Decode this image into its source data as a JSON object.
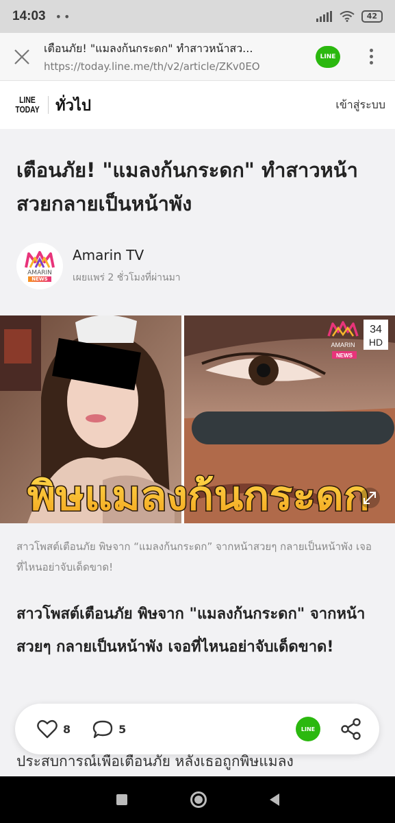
{
  "status_bar": {
    "time": "14:03",
    "dots": "••",
    "battery": "42"
  },
  "browser": {
    "page_title": "เตือนภัย! \"แมลงก้นกระดก\" ทำสาวหน้าสว...",
    "url": "https://today.line.me/th/v2/article/ZKv0EO",
    "line_badge": "LINE"
  },
  "site_header": {
    "logo_line1": "LINE",
    "logo_line2": "TODAY",
    "section": "ทั่วไป",
    "login": "เข้าสู่ระบบ"
  },
  "article": {
    "headline": "เตือนภัย! \"แมลงก้นกระดก\" ทำสาวหน้าสวยกลายเป็นหน้าพัง",
    "publisher": {
      "name": "Amarin TV",
      "time": "เผยแพร่ 2 ชั่วโมงที่ผ่านมา",
      "logo_text": "AMARIN",
      "logo_badge": "NEWS"
    },
    "image": {
      "overlay_text": "พิษแมลงก้นกระดก",
      "channel_number": "34",
      "channel_hd": "HD",
      "watermark_text": "AMARIN",
      "watermark_badge": "NEWS"
    },
    "caption": "สาวโพสต์เตือนภัย พิษจาก “แมลงก้นกระดก” จากหน้าสวยๆ กลายเป็นหน้าพัง เจอที่ไหนอย่าจับเด็ดขาด!",
    "lead": "สาวโพสต์เตือนภัย พิษจาก \"แมลงก้นกระดก\" จากหน้าสวยๆ กลายเป็นหน้าพัง เจอที่ไหนอย่าจับเด็ดขาด!",
    "body_partial": "ประสบการณ์เพื่อเตือนภัย หลังเธอถูกพิษแมลง"
  },
  "actions": {
    "likes": "8",
    "comments": "5",
    "line_share": "LINE"
  },
  "colors": {
    "line_green": "#2bb80f",
    "overlay_yellow": "#f7c531"
  }
}
